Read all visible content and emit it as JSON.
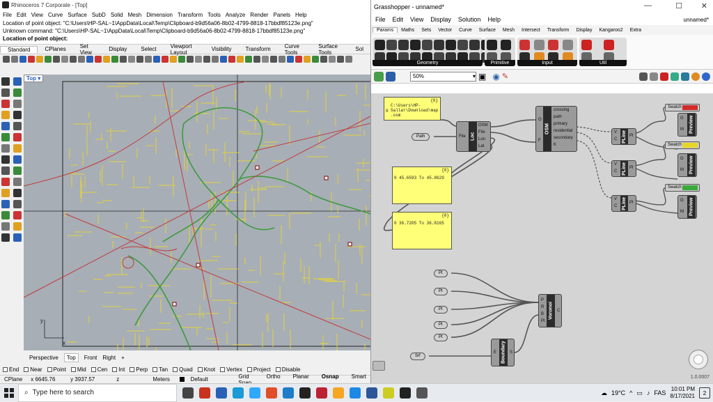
{
  "rhino": {
    "title": "Rhinoceros 7 Corporate - [Top]",
    "menu": [
      "File",
      "Edit",
      "View",
      "Curve",
      "Surface",
      "SubD",
      "Solid",
      "Mesh",
      "Dimension",
      "Transform",
      "Tools",
      "Analyze",
      "Render",
      "Panels",
      "Help"
    ],
    "command_lines": [
      "Location of point object: \"C:\\Users\\HP-SAL~1\\AppData\\Local\\Temp\\Clipboard-b9d56a06-8b02-4799-8818-17bbdf85123e.png\"",
      "Unknown command: \"C:\\Users\\HP-SAL~1\\AppData\\Local\\Temp\\Clipboard-b9d56a06-8b02-4799-8818-17bbdf85123e.png\""
    ],
    "prompt": "Location of point object:",
    "tabs": [
      "Standard",
      "CPlanes",
      "Set View",
      "Display",
      "Select",
      "Viewport Layout",
      "Visibility",
      "Transform",
      "Curve Tools",
      "Surface Tools",
      "Sol"
    ],
    "viewport_label": "Top",
    "viewport_tabs": [
      "Perspective",
      "Top",
      "Front",
      "Right"
    ],
    "axis_x": "x",
    "axis_y": "y",
    "osnaps": [
      "End",
      "Near",
      "Point",
      "Mid",
      "Cen",
      "Int",
      "Perp",
      "Tan",
      "Quad",
      "Knot",
      "Vertex",
      "Project",
      "Disable"
    ],
    "status": {
      "cplane": "CPlane",
      "x": "x 6645.76",
      "y": "y 3937.57",
      "z": "z",
      "units": "Meters",
      "layer": "Default",
      "modes": [
        "Grid Snap",
        "Ortho",
        "Planar",
        "Osnap",
        "Smart"
      ]
    }
  },
  "grasshopper": {
    "title": "Grasshopper - unnamed*",
    "menu": [
      "File",
      "Edit",
      "View",
      "Display",
      "Solution",
      "Help"
    ],
    "doc_name": "unnamed*",
    "tabs": [
      "Params",
      "Maths",
      "Sets",
      "Vector",
      "Curve",
      "Surface",
      "Mesh",
      "Intersect",
      "Transform",
      "Display",
      "Kangaroo2",
      "Extra"
    ],
    "ribbon_groups": [
      "Geometry",
      "Primitive",
      "Input",
      "Util"
    ],
    "zoom": "50%",
    "version": "1.0.0007",
    "panels": {
      "path": {
        "index": "{0}",
        "line_no": "0",
        "text": "C:\\Users\\HP-\nSallar\\Download\\map\n.osm"
      },
      "lon": {
        "index": "{0}",
        "line_no": "0",
        "text": "45.6593 To 45.8629"
      },
      "lat": {
        "index": "{0}",
        "line_no": "0",
        "text": "36.7205 To 36.8165"
      }
    },
    "components": {
      "path_param": "Path",
      "loc": {
        "name": "Loc",
        "in": "File",
        "outs": [
          "OSM",
          "File",
          "Lon",
          "Lat"
        ]
      },
      "osm": {
        "name": "OSM",
        "ins": [
          "O",
          "F"
        ],
        "outs": [
          "crossing",
          "path",
          "primary",
          "residential",
          "secondary",
          "K"
        ]
      },
      "pline": {
        "name": "PLine",
        "ins": [
          "V",
          "C"
        ],
        "out": "Pl"
      },
      "preview": {
        "name": "Preview",
        "ins": [
          "G",
          "M"
        ]
      },
      "swatch": "Swatch",
      "pt": "Pt",
      "voronoi": {
        "name": "Voronoi",
        "ins": [
          "P",
          "R",
          "B",
          "Pl"
        ],
        "out": "C"
      },
      "boundary": {
        "name": "Boundary",
        "in": "E",
        "out": "S"
      },
      "srf": "Srf"
    },
    "swatch_colors": [
      "#d22b2b",
      "#e8d52a",
      "#3aaa3a"
    ]
  },
  "taskbar": {
    "search_placeholder": "Type here to search",
    "weather": "19°C",
    "lang": "FAS",
    "time": "10:01 PM",
    "date": "8/17/2021",
    "notifications": "2"
  }
}
